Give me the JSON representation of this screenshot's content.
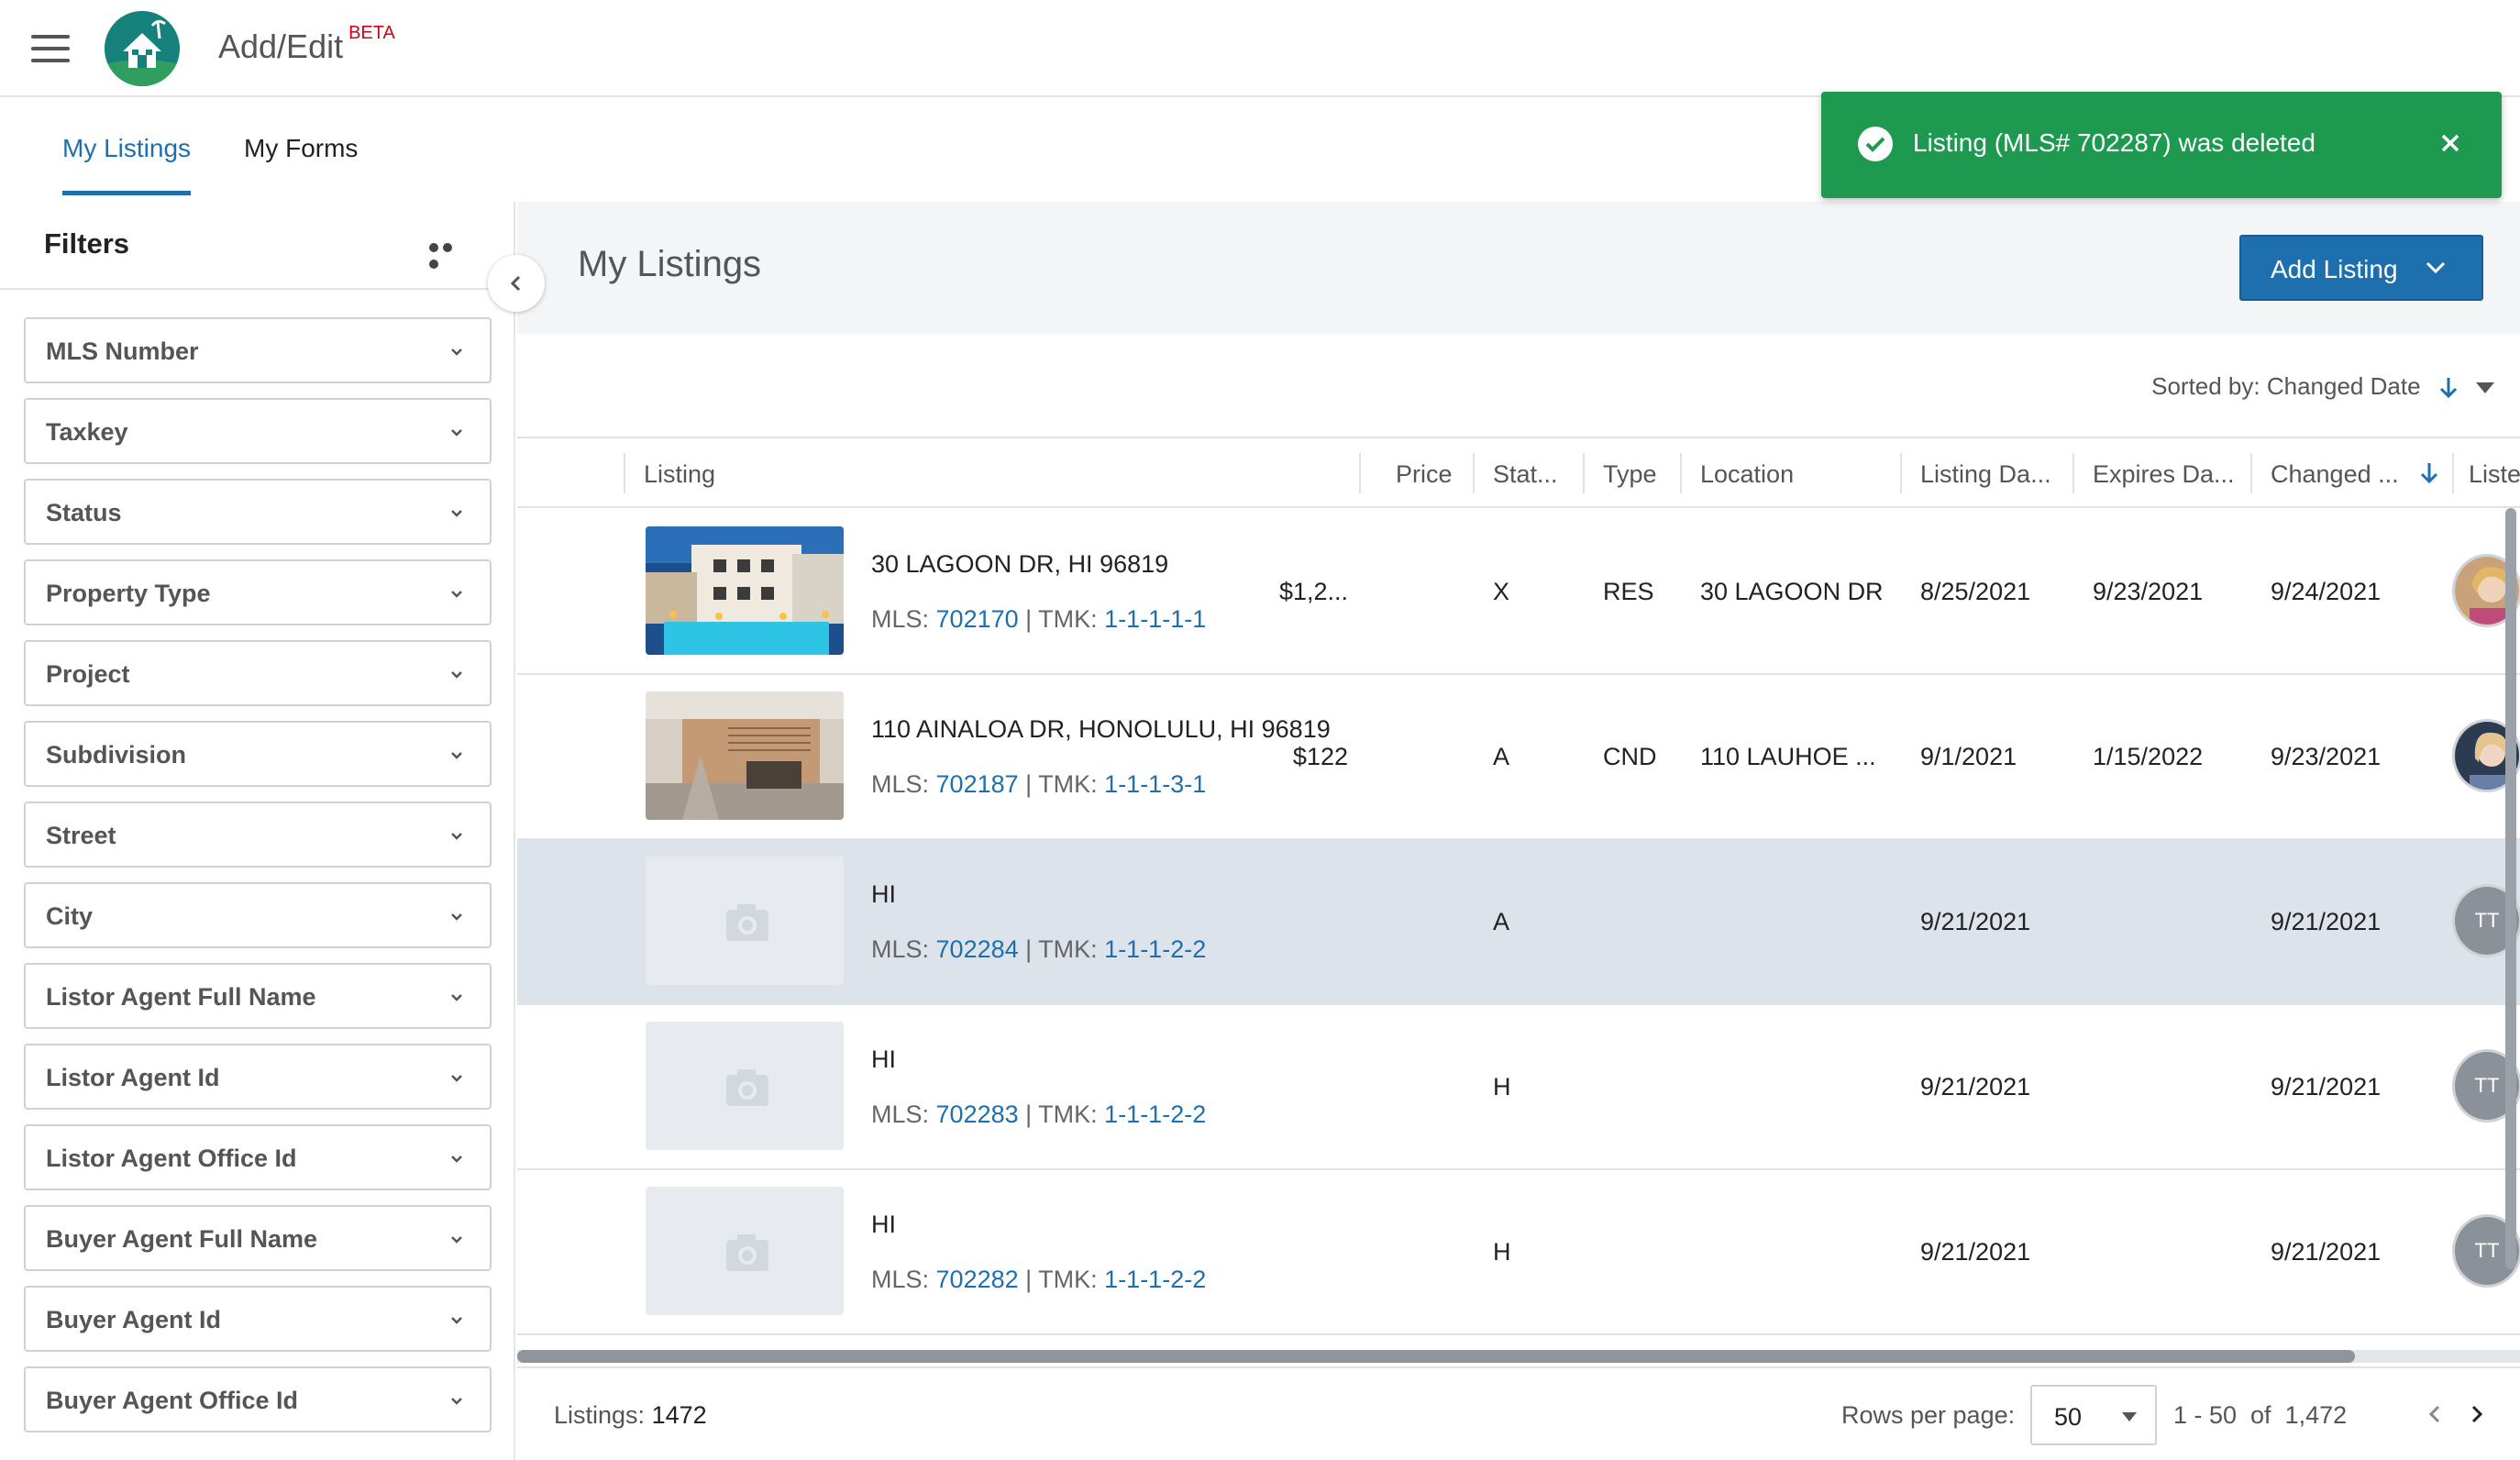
{
  "header": {
    "app_title": "Add/Edit",
    "beta_label": "BETA"
  },
  "tabs": [
    {
      "label": "My Listings",
      "active": true
    },
    {
      "label": "My Forms",
      "active": false
    }
  ],
  "toast": {
    "message": "Listing (MLS# 702287) was deleted",
    "color": "#1e9a50"
  },
  "sidebar": {
    "title": "Filters",
    "filters": [
      "MLS Number",
      "Taxkey",
      "Status",
      "Property Type",
      "Project",
      "Subdivision",
      "Street",
      "City",
      "Listor Agent Full Name",
      "Listor Agent Id",
      "Listor Agent Office Id",
      "Buyer Agent Full Name",
      "Buyer Agent Id",
      "Buyer Agent Office Id"
    ]
  },
  "main": {
    "title": "My Listings",
    "add_button": "Add Listing",
    "sort_label": "Sorted by: Changed Date",
    "accent": "#1e6fae"
  },
  "table": {
    "columns": [
      "Listing",
      "Price",
      "Stat...",
      "Type",
      "Location",
      "Listing Da...",
      "Expires Da...",
      "Changed ...",
      "Liste"
    ],
    "rows": [
      {
        "address": "30 LAGOON DR, HI 96819",
        "mls_prefix": "MLS: ",
        "mls": "702170",
        "tmk_prefix": " | TMK: ",
        "tmk": "1-1-1-1-1",
        "price": "$1,2...",
        "status": "X",
        "type": "RES",
        "location": "30 LAGOON DR",
        "listing_date": "8/25/2021",
        "expires_date": "9/23/2021",
        "changed_date": "9/24/2021",
        "agent_initials": ""
      },
      {
        "address": "110 AINALOA DR, HONOLULU, HI 96819",
        "mls_prefix": "MLS: ",
        "mls": "702187",
        "tmk_prefix": " | TMK: ",
        "tmk": "1-1-1-3-1",
        "price": "$122",
        "status": "A",
        "type": "CND",
        "location": "110 LAUHOE ...",
        "listing_date": "9/1/2021",
        "expires_date": "1/15/2022",
        "changed_date": "9/23/2021",
        "agent_initials": ""
      },
      {
        "address": "HI",
        "mls_prefix": "MLS: ",
        "mls": "702284",
        "tmk_prefix": " | TMK: ",
        "tmk": "1-1-1-2-2",
        "price": "",
        "status": "A",
        "type": "",
        "location": "",
        "listing_date": "9/21/2021",
        "expires_date": "",
        "changed_date": "9/21/2021",
        "agent_initials": "TT"
      },
      {
        "address": "HI",
        "mls_prefix": "MLS: ",
        "mls": "702283",
        "tmk_prefix": " | TMK: ",
        "tmk": "1-1-1-2-2",
        "price": "",
        "status": "H",
        "type": "",
        "location": "",
        "listing_date": "9/21/2021",
        "expires_date": "",
        "changed_date": "9/21/2021",
        "agent_initials": "TT"
      },
      {
        "address": "HI",
        "mls_prefix": "MLS: ",
        "mls": "702282",
        "tmk_prefix": " | TMK: ",
        "tmk": "1-1-1-2-2",
        "price": "",
        "status": "H",
        "type": "",
        "location": "",
        "listing_date": "9/21/2021",
        "expires_date": "",
        "changed_date": "9/21/2021",
        "agent_initials": "TT"
      }
    ]
  },
  "footer": {
    "listings_label": "Listings:",
    "listings_count": "1472",
    "rows_per_page_label": "Rows per page:",
    "rows_per_page": "50",
    "range": "1 - 50  of  1,472"
  }
}
